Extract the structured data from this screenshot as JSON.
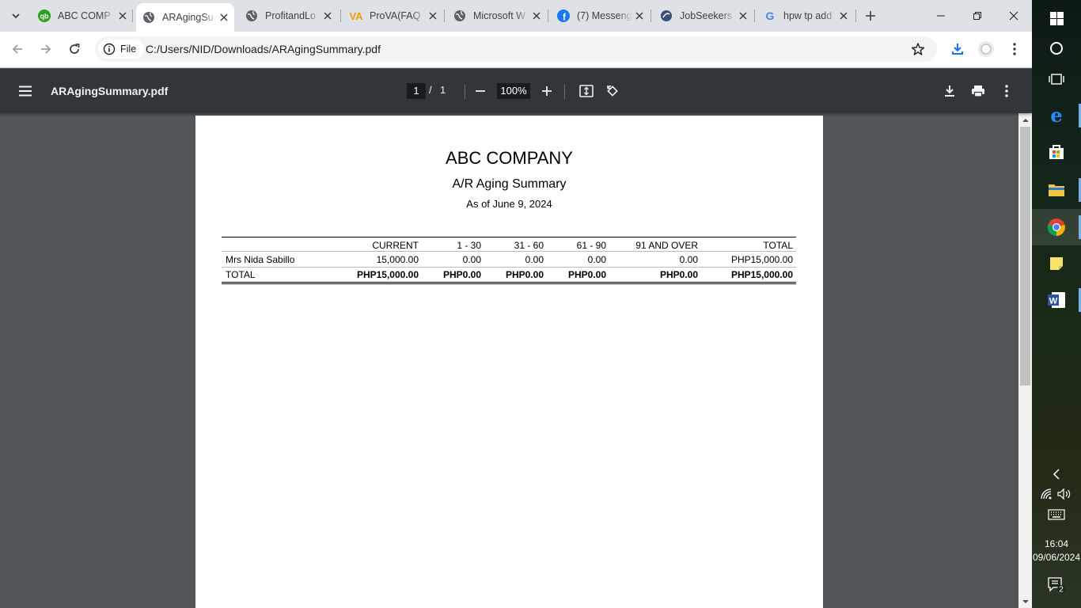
{
  "browser": {
    "tabs": [
      {
        "title": "ABC COMP",
        "favicon": "quickbooks-icon",
        "active": false
      },
      {
        "title": "ARAgingSu",
        "favicon": "globe-icon",
        "active": true
      },
      {
        "title": "ProfitandLo",
        "favicon": "globe-icon",
        "active": false
      },
      {
        "title": "ProVA(FAQ",
        "favicon": "va-logo-icon",
        "active": false
      },
      {
        "title": "Microsoft W",
        "favicon": "globe-icon",
        "active": false
      },
      {
        "title": "(7) Messeng",
        "favicon": "facebook-icon",
        "active": false
      },
      {
        "title": "JobSeekers",
        "favicon": "jobseekers-icon",
        "active": false
      },
      {
        "title": "hpw tp add",
        "favicon": "google-icon",
        "active": false
      }
    ],
    "omnibox": {
      "chip_label": "File",
      "url": "C:/Users/NID/Downloads/ARAgingSummary.pdf"
    }
  },
  "pdf_viewer": {
    "file_name": "ARAgingSummary.pdf",
    "current_page": "1",
    "page_separator": "/",
    "total_pages": "1",
    "zoom": "100%"
  },
  "report": {
    "company": "ABC COMPANY",
    "title": "A/R Aging Summary",
    "as_of": "As of June 9, 2024",
    "columns": [
      "",
      "CURRENT",
      "1 - 30",
      "31 - 60",
      "61 - 90",
      "91 AND OVER",
      "TOTAL"
    ],
    "rows": [
      {
        "name": "Mrs Nida Sabillo",
        "current": "15,000.00",
        "d1_30": "0.00",
        "d31_60": "0.00",
        "d61_90": "0.00",
        "d91_over": "0.00",
        "total": "PHP15,000.00"
      }
    ],
    "total_row": {
      "name": "TOTAL",
      "current": "PHP15,000.00",
      "d1_30": "PHP0.00",
      "d31_60": "PHP0.00",
      "d61_90": "PHP0.00",
      "d91_over": "PHP0.00",
      "total": "PHP15,000.00"
    }
  },
  "taskbar": {
    "time": "16:04",
    "date": "09/06/2024",
    "notification_count": "2"
  },
  "colors": {
    "tabstrip": "#dee1e6",
    "pdf_toolbar": "#323639",
    "pdf_background": "#525659",
    "accent": "#1a73e8"
  }
}
